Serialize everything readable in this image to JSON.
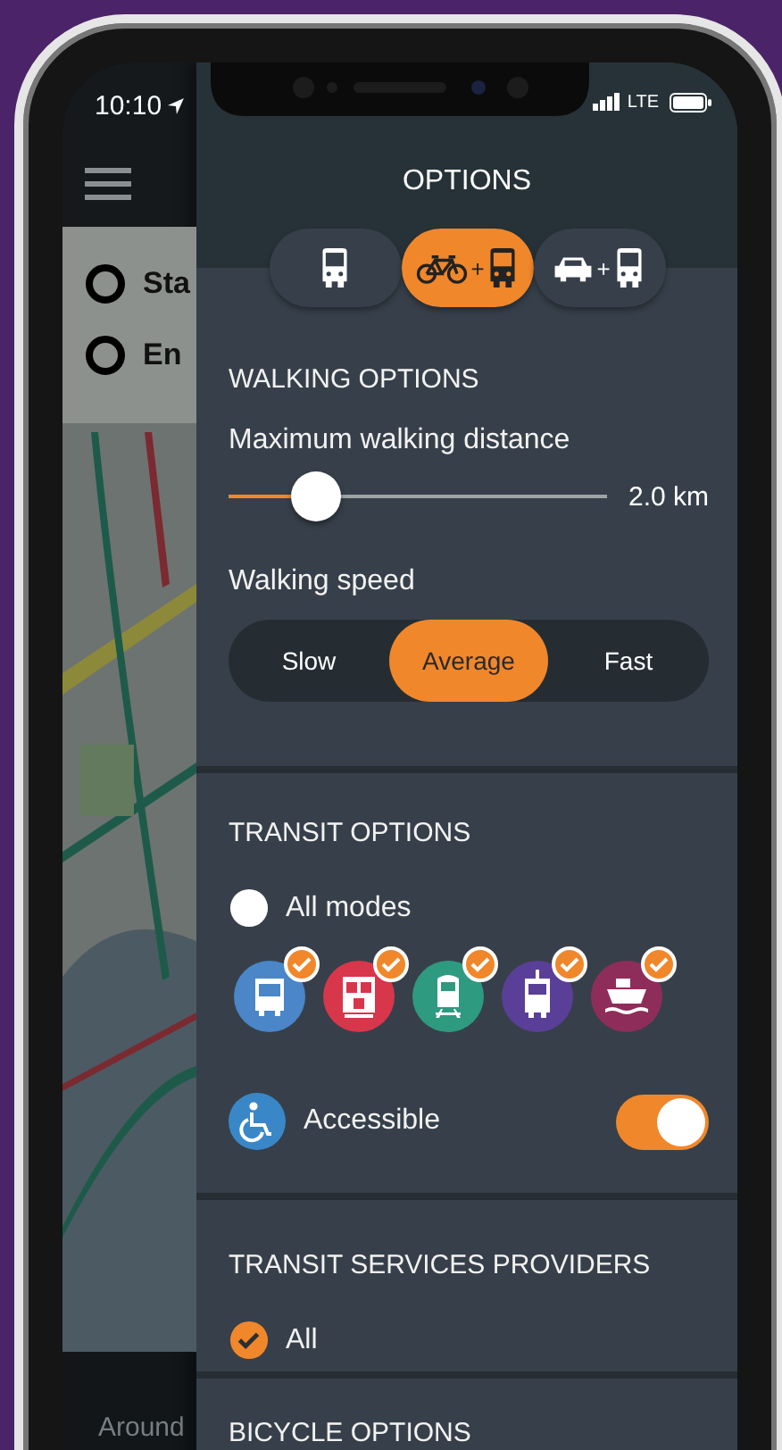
{
  "status_bar": {
    "time": "10:10",
    "network": "LTE"
  },
  "map_panel": {
    "route": [
      {
        "label": "Sta"
      },
      {
        "label": "En"
      }
    ],
    "bottom_label": "Around"
  },
  "options": {
    "title": "OPTIONS",
    "modes": [
      {
        "kind": "bus",
        "selected": false
      },
      {
        "kind": "bike_bus",
        "selected": true,
        "plus": "+"
      },
      {
        "kind": "car_bus",
        "selected": false,
        "plus": "+"
      }
    ],
    "walking": {
      "heading": "WALKING OPTIONS",
      "distance_label": "Maximum walking distance",
      "distance": {
        "level": 0.23,
        "reading": "2.0 km"
      },
      "speed_label": "Walking speed",
      "speeds": [
        {
          "label": "Slow",
          "selected": false
        },
        {
          "label": "Average",
          "selected": true
        },
        {
          "label": "Fast",
          "selected": false
        }
      ]
    },
    "transit": {
      "heading": "TRANSIT OPTIONS",
      "all_modes": {
        "label": "All modes",
        "checked": false
      },
      "modes": [
        {
          "kind": "bus",
          "color": "#4a86c8",
          "checked": true
        },
        {
          "kind": "rail",
          "color": "#d8364a",
          "checked": true
        },
        {
          "kind": "train",
          "color": "#2e9a80",
          "checked": true
        },
        {
          "kind": "tram",
          "color": "#5a3f98",
          "checked": true
        },
        {
          "kind": "ferry",
          "color": "#8f2d5a",
          "checked": true
        }
      ],
      "accessible": {
        "label": "Accessible",
        "on": true
      }
    },
    "providers": {
      "heading": "TRANSIT SERVICES PROVIDERS",
      "all": {
        "label": "All",
        "checked": true
      }
    },
    "bicycle": {
      "heading": "BICYCLE OPTIONS"
    }
  }
}
